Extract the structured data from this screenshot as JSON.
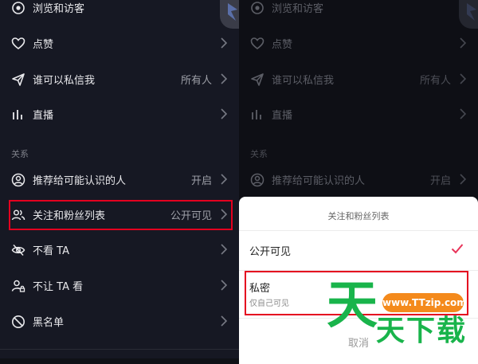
{
  "left": {
    "rows_top": [
      {
        "label": "浏览和访客",
        "value": "",
        "icon": "eye-icon"
      },
      {
        "label": "点赞",
        "value": "",
        "icon": "heart-icon"
      },
      {
        "label": "谁可以私信我",
        "value": "所有人",
        "icon": "send-icon"
      },
      {
        "label": "直播",
        "value": "",
        "icon": "bars-icon"
      }
    ],
    "section_label": "关系",
    "rows_relation": [
      {
        "label": "推荐给可能认识的人",
        "value": "开启",
        "icon": "user-circle-icon"
      },
      {
        "label": "关注和粉丝列表",
        "value": "公开可见",
        "icon": "users-icon"
      },
      {
        "label": "不看 TA",
        "value": "",
        "icon": "eye-off-icon"
      },
      {
        "label": "不让 TA 看",
        "value": "",
        "icon": "user-lock-icon"
      },
      {
        "label": "黑名单",
        "value": "",
        "icon": "block-icon"
      }
    ]
  },
  "right": {
    "rows": [
      {
        "label": "浏览和访客",
        "value": ""
      },
      {
        "label": "点赞",
        "value": ""
      },
      {
        "label": "谁可以私信我",
        "value": "所有人"
      },
      {
        "label": "直播",
        "value": ""
      },
      {
        "label": "推荐给可能认识的人",
        "value": "开启"
      }
    ],
    "section_label": "关系"
  },
  "sheet": {
    "title": "关注和粉丝列表",
    "option_public": "公开可见",
    "option_private": "私密",
    "option_private_desc": "仅自己可见",
    "cancel": "取消"
  },
  "watermark": {
    "url": "www.TTzip.com",
    "big_char": "天",
    "small_text": "天下载"
  },
  "colors": {
    "accent": "#e4001f",
    "check": "#e8345a",
    "watermark_green": "#19b44b",
    "watermark_orange": "#f48a1c"
  }
}
